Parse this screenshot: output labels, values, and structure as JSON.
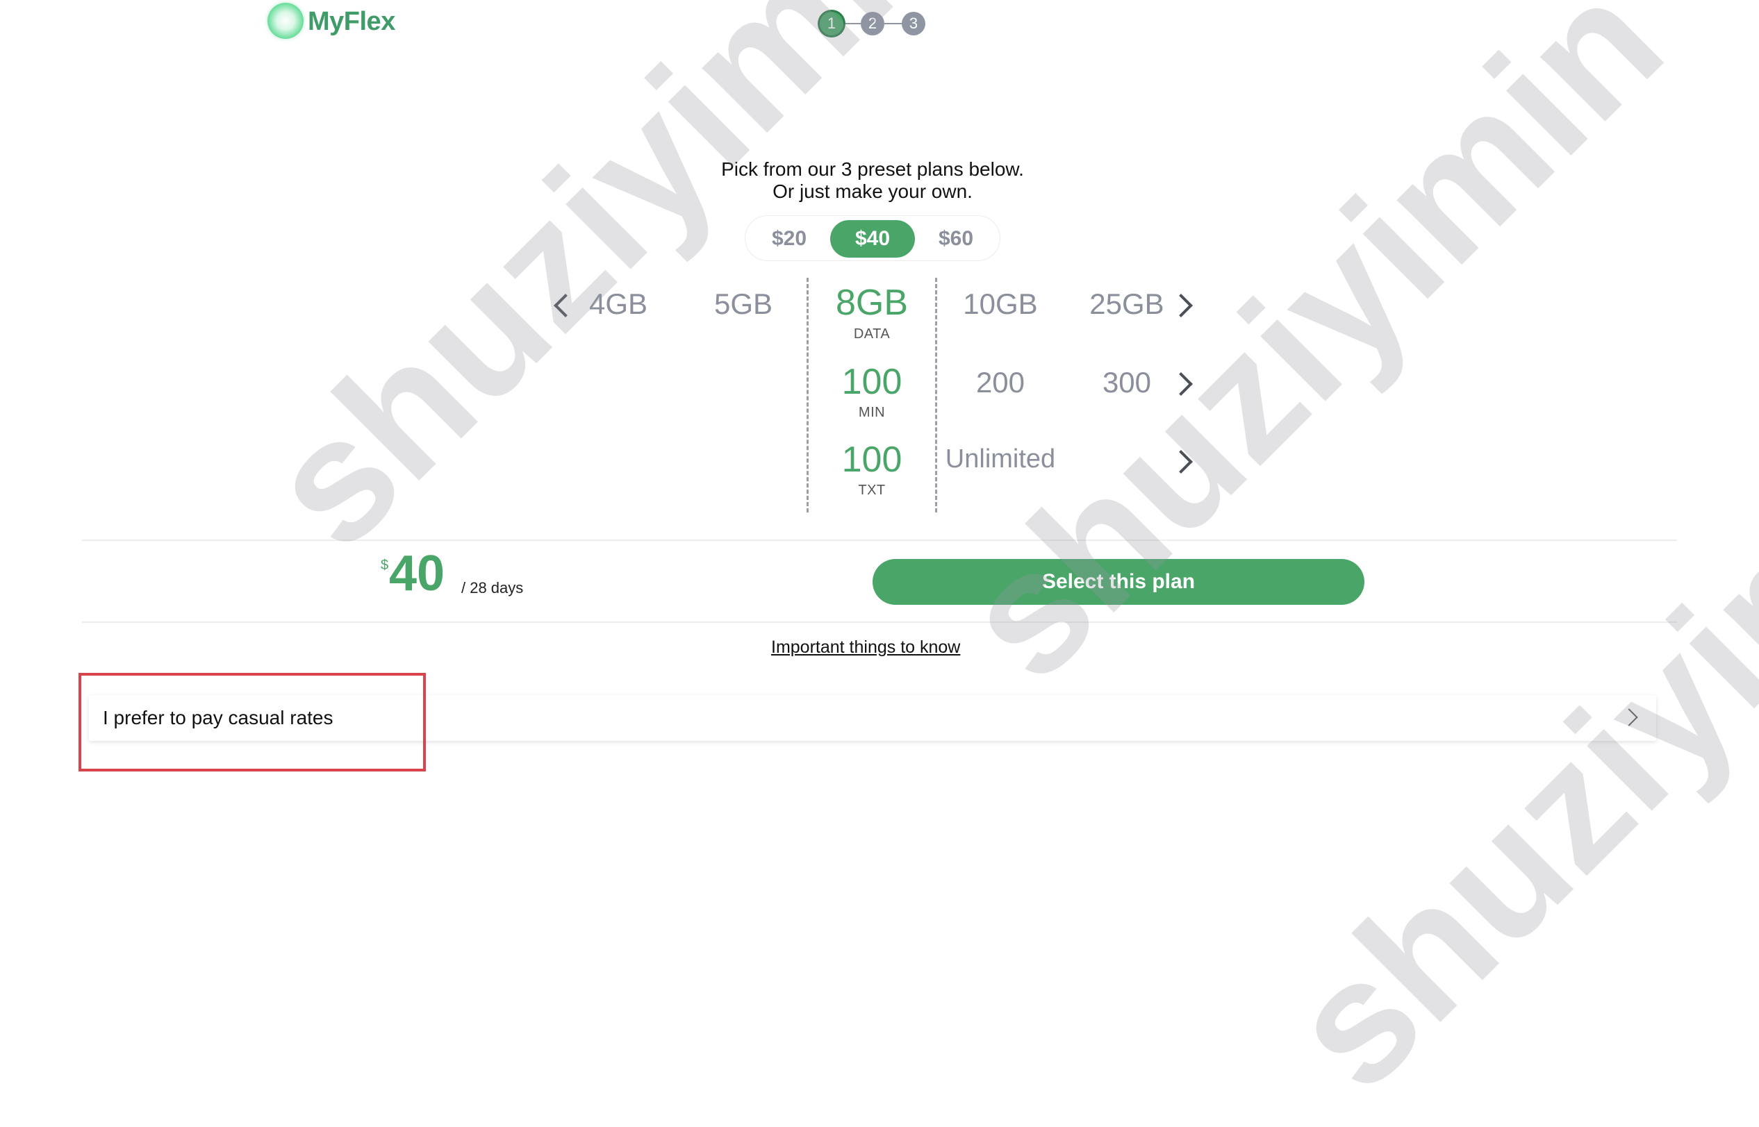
{
  "header": {
    "logo_text": "MyFlex",
    "steps": [
      "1",
      "2",
      "3"
    ],
    "active_step": 1
  },
  "intro": {
    "line1": "Pick from our 3 preset plans below.",
    "line2": "Or just make your own."
  },
  "price_toggle": {
    "options": [
      "$20",
      "$40",
      "$60"
    ],
    "selected": "$40"
  },
  "data_row": {
    "options": [
      "4GB",
      "5GB",
      "8GB",
      "10GB",
      "25GB"
    ],
    "selected": "8GB",
    "unit": "DATA"
  },
  "min_row": {
    "options": [
      "100",
      "200",
      "300"
    ],
    "selected": "100",
    "unit": "MIN"
  },
  "txt_row": {
    "options": [
      "100",
      "Unlimited"
    ],
    "selected": "100",
    "unit": "TXT"
  },
  "summary": {
    "currency": "$",
    "price": "40",
    "period": "/ 28 days",
    "select_label": "Select this plan"
  },
  "links": {
    "important": "Important things to know"
  },
  "casual": {
    "label": "I prefer to pay casual rates"
  },
  "watermark": {
    "text1": "shuziyimin",
    "text2": "shuziyimin.org"
  },
  "colors": {
    "brand_green": "#4aa569",
    "muted_gray": "#8a8f9b",
    "highlight_red": "#d9444a"
  }
}
